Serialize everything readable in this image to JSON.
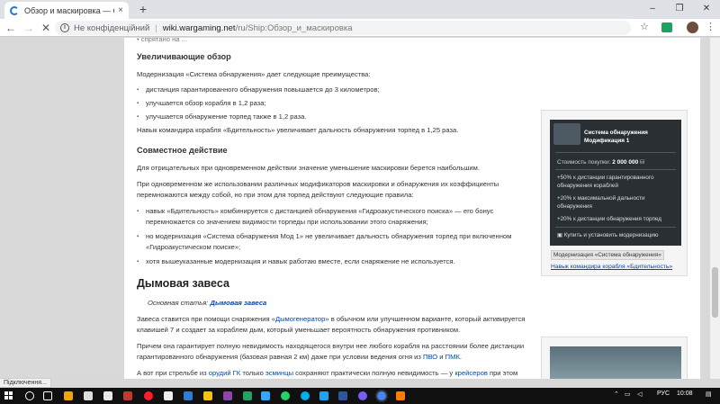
{
  "browser": {
    "tab_title": "Обзор и маскировка — Global",
    "tab_close": "×",
    "new_tab": "+",
    "window_min": "–",
    "window_max": "❐",
    "window_close": "✕",
    "back": "←",
    "forward": "→",
    "stop": "✕",
    "security_label": "Не конфіденційний",
    "url_host": "wiki.wargaming.net",
    "url_path": "/ru/Ship:Обзор_и_маскировка",
    "star": "☆",
    "menu": "⋮"
  },
  "article": {
    "cut_top_text": "• спрятано на ...",
    "section1": {
      "heading": "Увеличивающие обзор",
      "intro": "Модернизация «Система обнаружения» дает следующие преимущества:",
      "bullets": [
        "дистанция гарантированного обнаружения повышается до 3 километров;",
        "улучшается обзор корабля в 1,2 раза;",
        "улучшается обнаружение торпед также в 1,2 раза."
      ],
      "skill_note": "Навык командира корабля «Бдительность» увеличивает дальность обнаружения торпед в 1,25 раза."
    },
    "section2": {
      "heading": "Совместное действие",
      "p1": "Для отрицательных при одновременном действии значение уменьшение маскировки берется наибольшим.",
      "p2_line1": "При одновременном же использовании различных модификаторов маскировки и обнаружения их коэффициенты",
      "p2_line2": "перемножаются между собой, но при этом для торпед действуют следующие правила:",
      "bullets": [
        [
          "навык «Бдительность» комбинируется с дистанцией обнаружения «Гидроакустического поиска» — его бонус",
          "перемножается со значением видимости торпеды при использовании этого снаряжения;"
        ],
        [
          "но модернизация «Система обнаружения Мод 1» не увеличивает дальность обнаружения торпед при включенном",
          "«Гидроакустическом поиске»;"
        ],
        [
          "хотя вышеуказанные модернизация и навык работаю вместе, если снаряжение не используется.",
          ""
        ]
      ]
    },
    "section3": {
      "heading": "Дымовая завеса",
      "main_article_prefix": "Основная статья: ",
      "main_article_link": "Дымовая завеса",
      "p1_a": "Завеса ставится при помощи снаряжения «",
      "p1_link": "Дымогенератор",
      "p1_b": "» в обычном или улучшенном варианте, который активируется",
      "p1_line2": "клавишей 7 и создает за кораблем дым, который уменьшает вероятность обнаружения противником.",
      "p2_line1": "Причем она гарантирует полную невидимость находящегося внутри нее любого корабля на расстоянии более дистанции",
      "p2_line2_a": "гарантированного обнаружения (базовая равная 2 км) даже при условии ведения огня из ",
      "p2_link1": "ПВО",
      "p2_and": " и ",
      "p2_link2": "ПМК",
      "p2_end": ".",
      "p3_a": "А вот при стрельбе из ",
      "p3_link1": "орудий ГК",
      "p3_b": " только ",
      "p3_link2": "эсминцы",
      "p3_c": " сохраняют практически полную невидимость — у ",
      "p3_link3": "крейсеров",
      "p3_d": " при этом"
    }
  },
  "infobox": {
    "card_name_line1": "Система обнаружения",
    "card_name_line2": "Модификация 1",
    "cost_label": "Стоимость покупки:",
    "cost_value": "2 000 000",
    "bonus1": "+50% к дистанции гарантированного обнаружения кораблей",
    "bonus2": "+20% к максимальной дальности обнаружения",
    "bonus3": "+20% к дистанции обнаружения торпед",
    "action": "Купить и установить модернизацию",
    "tag": "Модернизация «Система обнаружения»",
    "skill_link": "Навык командира корабля «Бдительность»"
  },
  "status_text": "Підключення...",
  "taskbar": {
    "lang": "РУС",
    "time": "10:08"
  }
}
